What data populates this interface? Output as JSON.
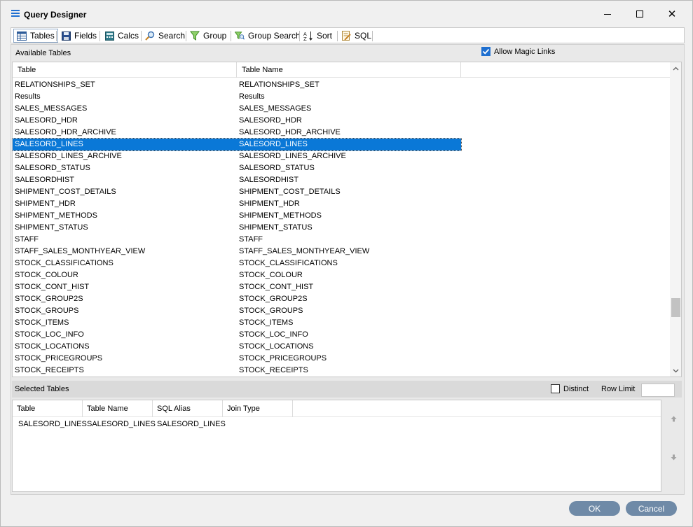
{
  "window": {
    "title": "Query Designer",
    "minimize_glyph": "",
    "maximize_glyph": "",
    "close_glyph": "✕"
  },
  "tabs": [
    {
      "label": "Tables",
      "icon": "table-icon",
      "active": true
    },
    {
      "label": "Fields",
      "icon": "save-disk-icon",
      "active": false
    },
    {
      "label": "Calcs",
      "icon": "calculator-icon",
      "active": false
    },
    {
      "label": "Search",
      "icon": "magnifier-icon",
      "active": false
    },
    {
      "label": "Group",
      "icon": "funnel-icon",
      "active": false
    },
    {
      "label": "Group Search",
      "icon": "funnel-search-icon",
      "active": false
    },
    {
      "label": "Sort",
      "icon": "sort-az-icon",
      "active": false
    },
    {
      "label": "SQL",
      "icon": "sql-document-icon",
      "active": false
    }
  ],
  "available": {
    "label": "Available Tables",
    "magic_links_label": "Allow Magic Links",
    "magic_links_checked": true,
    "columns": [
      "Table",
      "Table Name"
    ],
    "rows": [
      [
        "RELATIONSHIPS_SET",
        "RELATIONSHIPS_SET"
      ],
      [
        "Results",
        "Results"
      ],
      [
        "SALES_MESSAGES",
        "SALES_MESSAGES"
      ],
      [
        "SALESORD_HDR",
        "SALESORD_HDR"
      ],
      [
        "SALESORD_HDR_ARCHIVE",
        "SALESORD_HDR_ARCHIVE"
      ],
      [
        "SALESORD_LINES",
        "SALESORD_LINES"
      ],
      [
        "SALESORD_LINES_ARCHIVE",
        "SALESORD_LINES_ARCHIVE"
      ],
      [
        "SALESORD_STATUS",
        "SALESORD_STATUS"
      ],
      [
        "SALESORDHIST",
        "SALESORDHIST"
      ],
      [
        "SHIPMENT_COST_DETAILS",
        "SHIPMENT_COST_DETAILS"
      ],
      [
        "SHIPMENT_HDR",
        "SHIPMENT_HDR"
      ],
      [
        "SHIPMENT_METHODS",
        "SHIPMENT_METHODS"
      ],
      [
        "SHIPMENT_STATUS",
        "SHIPMENT_STATUS"
      ],
      [
        "STAFF",
        "STAFF"
      ],
      [
        "STAFF_SALES_MONTHYEAR_VIEW",
        "STAFF_SALES_MONTHYEAR_VIEW"
      ],
      [
        "STOCK_CLASSIFICATIONS",
        "STOCK_CLASSIFICATIONS"
      ],
      [
        "STOCK_COLOUR",
        "STOCK_COLOUR"
      ],
      [
        "STOCK_CONT_HIST",
        "STOCK_CONT_HIST"
      ],
      [
        "STOCK_GROUP2S",
        "STOCK_GROUP2S"
      ],
      [
        "STOCK_GROUPS",
        "STOCK_GROUPS"
      ],
      [
        "STOCK_ITEMS",
        "STOCK_ITEMS"
      ],
      [
        "STOCK_LOC_INFO",
        "STOCK_LOC_INFO"
      ],
      [
        "STOCK_LOCATIONS",
        "STOCK_LOCATIONS"
      ],
      [
        "STOCK_PRICEGROUPS",
        "STOCK_PRICEGROUPS"
      ],
      [
        "STOCK_RECEIPTS",
        "STOCK_RECEIPTS"
      ]
    ],
    "selected_row": 5
  },
  "selected": {
    "label": "Selected Tables",
    "distinct_label": "Distinct",
    "distinct_checked": false,
    "row_limit_label": "Row Limit",
    "row_limit_value": "",
    "columns": [
      "Table",
      "Table Name",
      "SQL Alias",
      "Join Type"
    ],
    "rows": [
      [
        "SALESORD_LINES",
        "SALESORD_LINES",
        "SALESORD_LINES",
        ""
      ]
    ]
  },
  "buttons": {
    "ok": "OK",
    "cancel": "Cancel"
  },
  "colors": {
    "selection": "#0a78d7",
    "button": "#6f8aa7",
    "accent": "#1e6fd0"
  }
}
